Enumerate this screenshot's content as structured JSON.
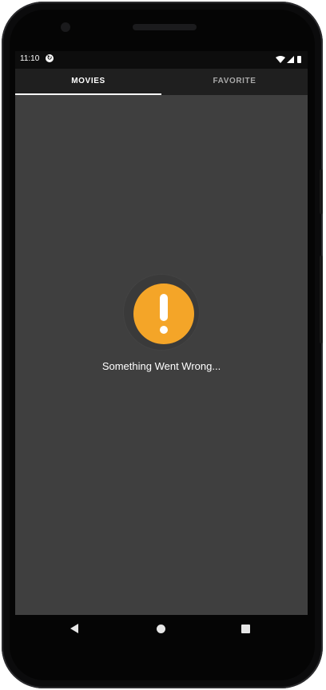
{
  "status_bar": {
    "time": "11:10",
    "sync_icon": "sync-icon",
    "icons": [
      "wifi-icon",
      "signal-icon",
      "battery-icon"
    ]
  },
  "tabs": [
    {
      "label": "MOVIES",
      "selected": true
    },
    {
      "label": "FAVORITE",
      "selected": false
    }
  ],
  "error": {
    "icon": "warning-icon",
    "message": "Something Went Wrong...",
    "accent_color": "#f4a528"
  },
  "nav_bar": {
    "buttons": [
      "back-icon",
      "home-icon",
      "recents-icon"
    ]
  },
  "colors": {
    "screen_bg": "#3f3f3f",
    "tabbar_bg": "#1f1f1f",
    "indicator": "#ffffff"
  }
}
